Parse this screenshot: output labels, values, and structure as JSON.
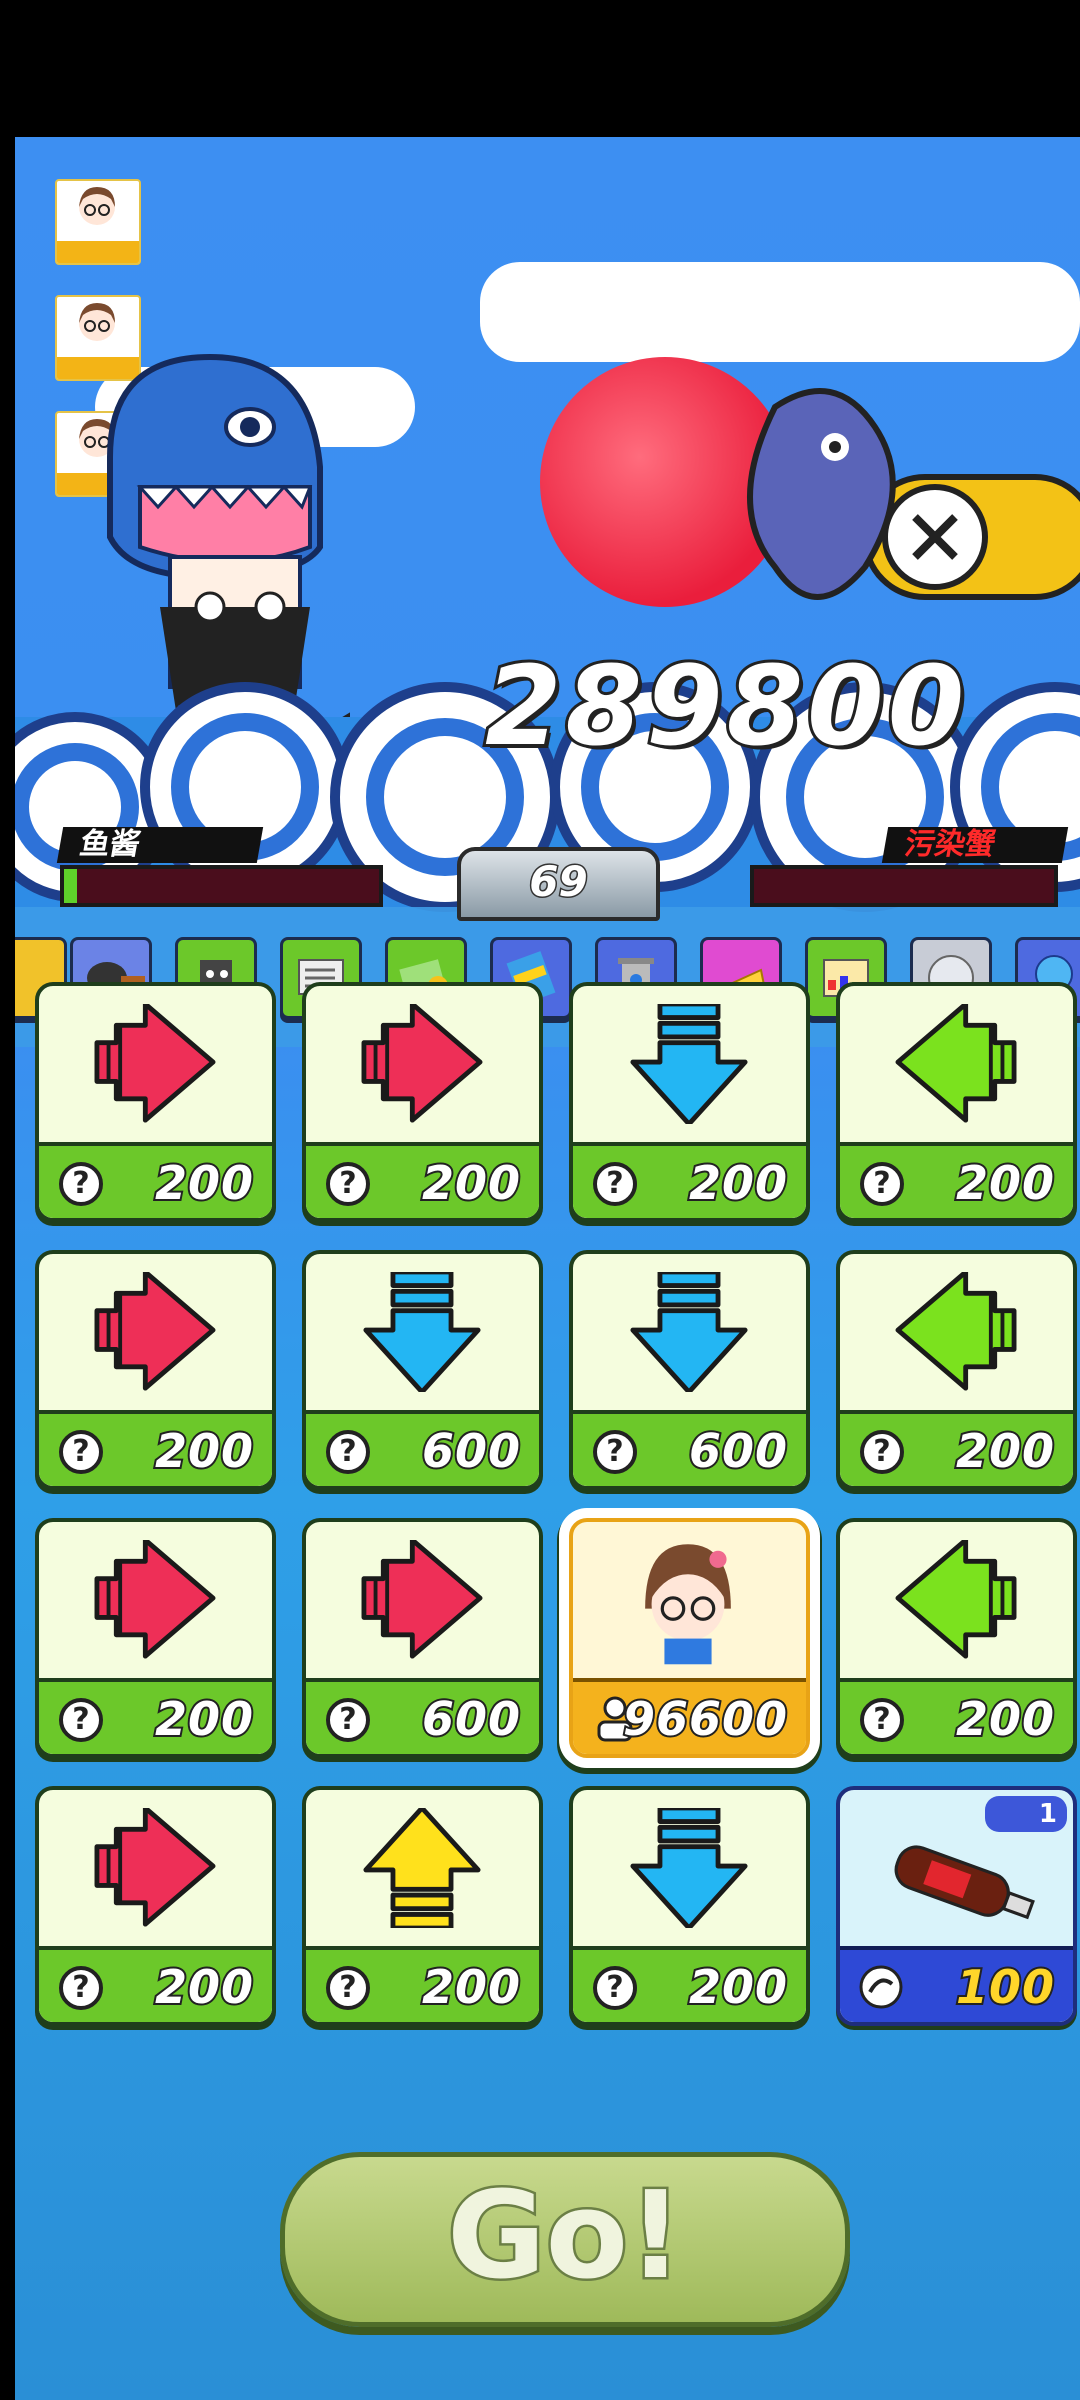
{
  "hud": {
    "score": "289800",
    "level": "69",
    "player_name": "鱼酱",
    "enemy_name": "污染蟹",
    "side_avatars": [
      "玩家1",
      "玩家2",
      "玩家3"
    ]
  },
  "items_row": [
    "frying-pan",
    "robot",
    "newspaper",
    "money",
    "battery",
    "trash-can",
    "cheese",
    "box",
    "glass-ball",
    "balloon"
  ],
  "cards": [
    {
      "kind": "arrow",
      "direction": "right",
      "price": "200"
    },
    {
      "kind": "arrow",
      "direction": "right",
      "price": "200"
    },
    {
      "kind": "arrow",
      "direction": "down",
      "price": "200"
    },
    {
      "kind": "arrow",
      "direction": "left",
      "price": "200"
    },
    {
      "kind": "arrow",
      "direction": "right",
      "price": "200"
    },
    {
      "kind": "arrow",
      "direction": "down",
      "price": "600"
    },
    {
      "kind": "arrow",
      "direction": "down",
      "price": "600"
    },
    {
      "kind": "arrow",
      "direction": "left",
      "price": "200"
    },
    {
      "kind": "arrow",
      "direction": "right",
      "price": "200"
    },
    {
      "kind": "arrow",
      "direction": "right",
      "price": "600"
    },
    {
      "kind": "character",
      "price": "96600"
    },
    {
      "kind": "arrow",
      "direction": "left",
      "price": "200"
    },
    {
      "kind": "arrow",
      "direction": "right",
      "price": "200"
    },
    {
      "kind": "arrow",
      "direction": "up",
      "price": "200"
    },
    {
      "kind": "arrow",
      "direction": "down",
      "price": "200"
    },
    {
      "kind": "cola",
      "price": "100",
      "badge": "1"
    }
  ],
  "go_label": "Go!",
  "colors": {
    "right": "#ee2f57",
    "down": "#23b6f3",
    "left": "#7be21e",
    "up": "#ffe11c"
  }
}
